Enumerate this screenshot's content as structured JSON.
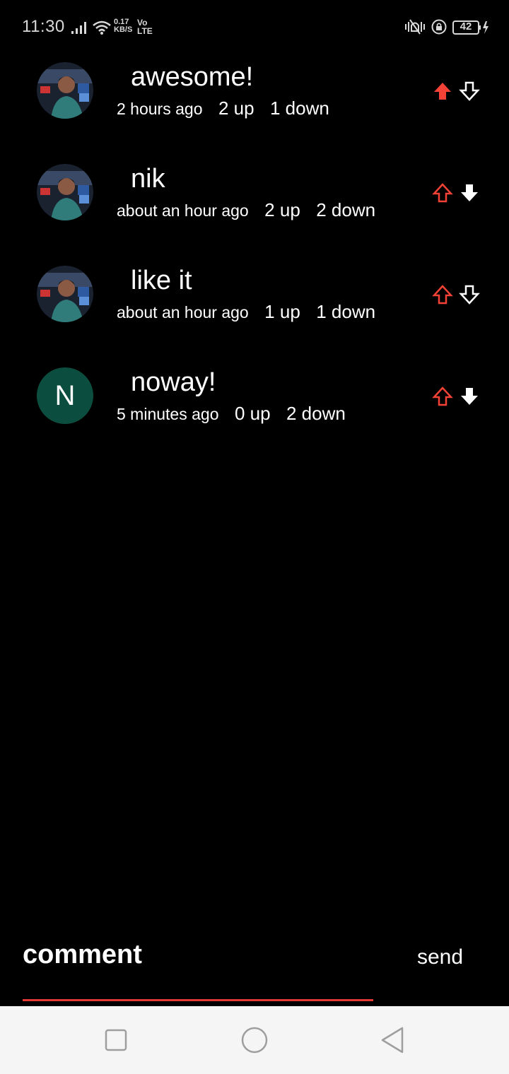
{
  "status_bar": {
    "time": "11:30",
    "speed_value": "0.17",
    "speed_unit": "KB/S",
    "net_top": "Vo",
    "net_bottom": "LTE",
    "battery": "42",
    "icons": [
      "signal-icon",
      "wifi-icon",
      "vibrate-icon",
      "lock-icon",
      "battery-icon",
      "charging-icon"
    ]
  },
  "comments": [
    {
      "text": "awesome!",
      "time": "2 hours ago",
      "up": "2 up",
      "down": "1 down",
      "avatar": "photo",
      "upvoted": true,
      "downvoted": false
    },
    {
      "text": "nik",
      "time": "about an hour ago",
      "up": "2 up",
      "down": "2 down",
      "avatar": "photo",
      "upvoted": false,
      "downvoted": true
    },
    {
      "text": "like it",
      "time": "about an hour ago",
      "up": "1 up",
      "down": "1 down",
      "avatar": "photo",
      "upvoted": false,
      "downvoted": false
    },
    {
      "text": "noway!",
      "time": "5 minutes ago",
      "up": "0 up",
      "down": "2 down",
      "avatar": "N",
      "upvoted": false,
      "downvoted": true
    }
  ],
  "composer": {
    "placeholder": "comment",
    "value": "",
    "send_label": "send"
  },
  "colors": {
    "upvote": "#f44336",
    "downvote": "#ffffff",
    "underline": "#e53935",
    "avatar_letter_bg": "#0b4e3f",
    "nav_bg": "#f5f5f5"
  },
  "nav_bar": {
    "buttons": [
      "recents-square-icon",
      "home-circle-icon",
      "back-triangle-icon"
    ]
  }
}
